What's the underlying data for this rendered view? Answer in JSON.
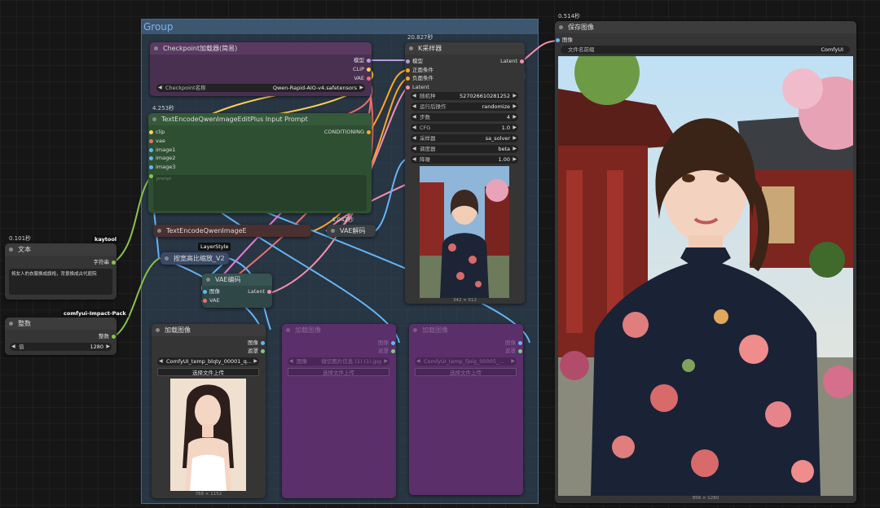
{
  "group": {
    "title": "Group"
  },
  "checkpoint": {
    "title": "Checkpoint加载器(简易)",
    "outputs": [
      "模型",
      "CLIP",
      "VAE"
    ],
    "widget_label": "Checkpoint名称",
    "widget_value": "Qwen-Rapid-AIO-v4.safetensors"
  },
  "textencode": {
    "time": "4.253秒",
    "title": "TextEncodeQwenImageEditPlus Input Prompt",
    "inputs": [
      "clip",
      "vae",
      "image1",
      "image2",
      "image3"
    ],
    "output": "CONDITIONING",
    "prompt_placeholder": "prompt"
  },
  "textencode_small": {
    "title": "TextEncodeQwenImageE"
  },
  "vae_decode_small": {
    "time": "4.042秒",
    "title": "VAE解码"
  },
  "layerstyle": {
    "tag": "LayerStyle",
    "title": "按宽高比缩放_V2"
  },
  "vae_encode": {
    "title": "VAE编码",
    "inputs": [
      "图像",
      "VAE"
    ],
    "output": "Latent"
  },
  "ksampler": {
    "time": "20.827秒",
    "title": "K采样器",
    "inputs": [
      "模型",
      "正面条件",
      "负面条件",
      "Latent"
    ],
    "output": "Latent",
    "widgets": [
      {
        "label": "随机种",
        "value": "527026610281252"
      },
      {
        "label": "运行后操作",
        "value": "randomize"
      },
      {
        "label": "步数",
        "value": "4"
      },
      {
        "label": "CFG",
        "value": "1.0"
      },
      {
        "label": "采样器",
        "value": "sa_solver"
      },
      {
        "label": "调度器",
        "value": "beta"
      },
      {
        "label": "降噪",
        "value": "1.00"
      }
    ],
    "image_size": "342 × 512"
  },
  "save": {
    "time": "0.514秒",
    "title": "保存图像",
    "input": "图像",
    "widget_label": "文件名前缀",
    "widget_value": "ComfyUI",
    "image_size": "856 × 1280"
  },
  "text_node": {
    "time": "0.101秒",
    "tag": "kaytool",
    "title": "文本",
    "output": "字符串",
    "text": "将女人的衣服换成旗袍，背景换成古代庭院"
  },
  "int_node": {
    "tag": "comfyui-Impact-Pack",
    "title": "整数",
    "output": "整数",
    "widget_label": "值",
    "widget_value": "1280"
  },
  "load1": {
    "title": "加载图像",
    "outputs": [
      "图像",
      "遮罩"
    ],
    "widget_value": "ComfyUI_temp_blqty_00001_q...",
    "button": "选择文件上传",
    "image_size": "768 × 1152"
  },
  "load2": {
    "title": "加载图像",
    "outputs": [
      "图像",
      "遮罩"
    ],
    "widget_label": "图像",
    "widget_value": "微信图片信息 (1) (1).jpg",
    "button": "选择文件上传"
  },
  "load3": {
    "title": "加载图像",
    "outputs": [
      "图像",
      "遮罩"
    ],
    "widget_value": "ComfyUI_temp_fjoig_00005_...",
    "button": "选择文件上传"
  }
}
